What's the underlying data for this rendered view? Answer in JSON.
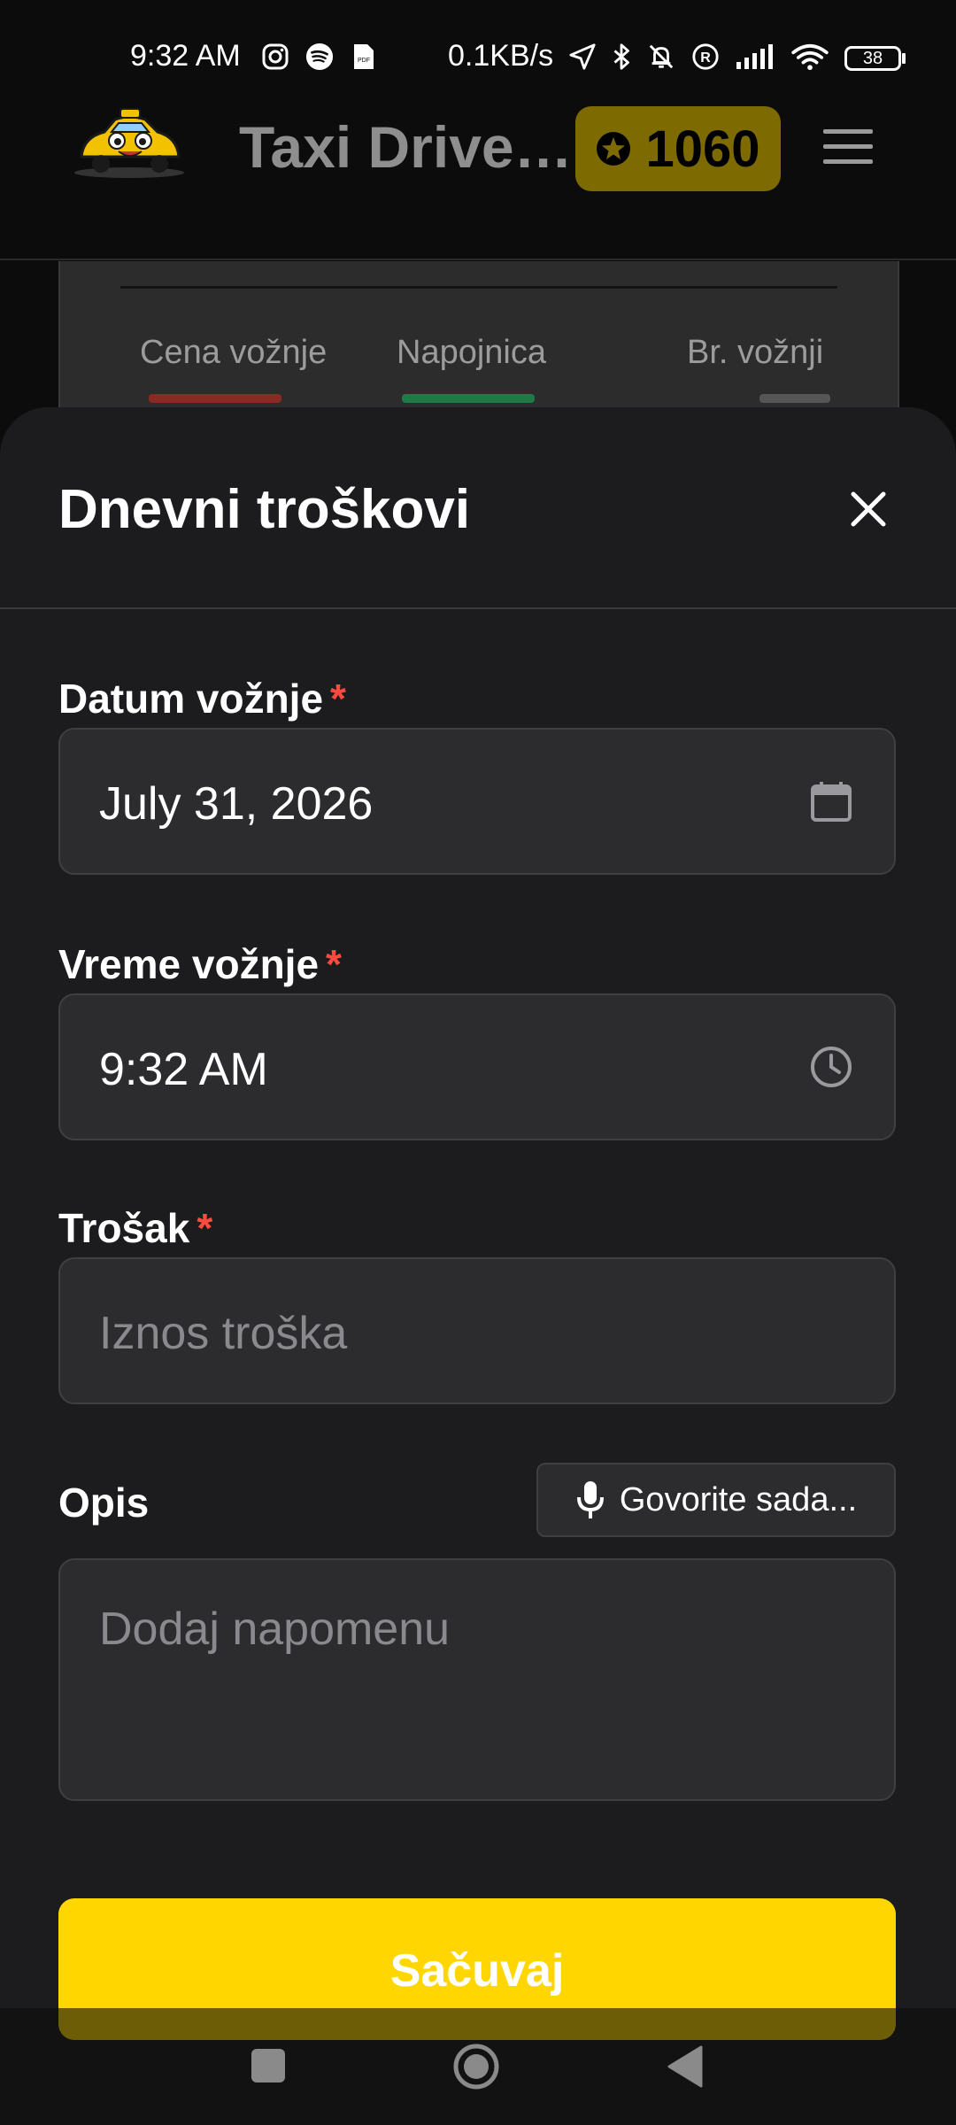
{
  "status_bar": {
    "time": "9:32 AM",
    "net_speed": "0.1KB/s",
    "battery": "38",
    "icons": [
      "instagram-icon",
      "spotify-icon",
      "pdf-icon",
      "location-arrow-icon",
      "bluetooth-icon",
      "muted-bell-icon",
      "registered-icon",
      "signal-icon",
      "wifi-icon",
      "battery-icon"
    ]
  },
  "header": {
    "title": "Taxi Driver...",
    "points": "1060",
    "points_icon": "star-badge-icon",
    "menu_icon": "hamburger-menu-icon"
  },
  "background_card": {
    "labels": [
      "Cena vožnje",
      "Napojnica",
      "Br. vožnji"
    ],
    "value_colors": [
      "#c0392b",
      "#27ae60",
      "#9a9a9a"
    ]
  },
  "sheet": {
    "title": "Dnevni troškovi",
    "close_icon": "close-icon",
    "fields": {
      "date": {
        "label": "Datum vožnje",
        "required_mark": "*",
        "value": "July 31, 2026",
        "icon": "calendar-icon"
      },
      "time": {
        "label": "Vreme vožnje",
        "required_mark": "*",
        "value": "9:32 AM",
        "icon": "clock-icon"
      },
      "cost": {
        "label": "Trošak",
        "required_mark": "*",
        "placeholder": "Iznos troška"
      },
      "description": {
        "label": "Opis",
        "placeholder": "Dodaj napomenu"
      }
    },
    "voice_button": {
      "label": "Govorite sada...",
      "icon": "microphone-icon"
    },
    "save_button": {
      "label": "Sačuvaj"
    }
  },
  "colors": {
    "accent": "#ffd600",
    "badge": "#7d6a00",
    "required": "#ff4b3e",
    "sheet_bg": "#1c1c1e",
    "field_bg": "#2c2c2e"
  },
  "nav_bar": {
    "buttons": [
      "recents-square-icon",
      "home-circle-icon",
      "back-triangle-icon"
    ]
  }
}
